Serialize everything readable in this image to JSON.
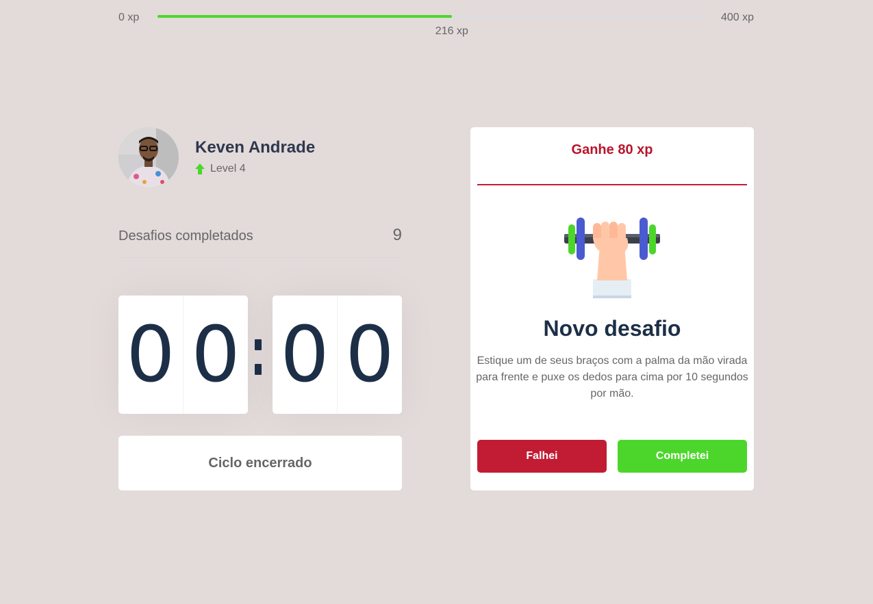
{
  "xp": {
    "min_label": "0 xp",
    "max_label": "400 xp",
    "current_label": "216 xp",
    "current": 216,
    "max": 400,
    "fill_color": "#4cd62b"
  },
  "profile": {
    "name": "Keven Andrade",
    "level_label": "Level 4",
    "level_icon": "level-up-arrow-icon"
  },
  "challenges": {
    "label": "Desafios completados",
    "count": "9"
  },
  "timer": {
    "minutes": [
      "0",
      "0"
    ],
    "seconds": [
      "0",
      "0"
    ]
  },
  "cycle_button": {
    "label": "Ciclo encerrado"
  },
  "challenge_card": {
    "reward": "Ganhe 80 xp",
    "illustration": "dumbbell-icon",
    "title": "Novo desafio",
    "description": "Estique um de seus braços com a palma da mão virada para frente e puxe os dedos para cima por 10 segundos por mão.",
    "fail_label": "Falhei",
    "complete_label": "Completei"
  },
  "colors": {
    "background": "#e3dada",
    "red": "#c11c34",
    "green": "#4cd62b",
    "digit": "#1d2f47"
  }
}
